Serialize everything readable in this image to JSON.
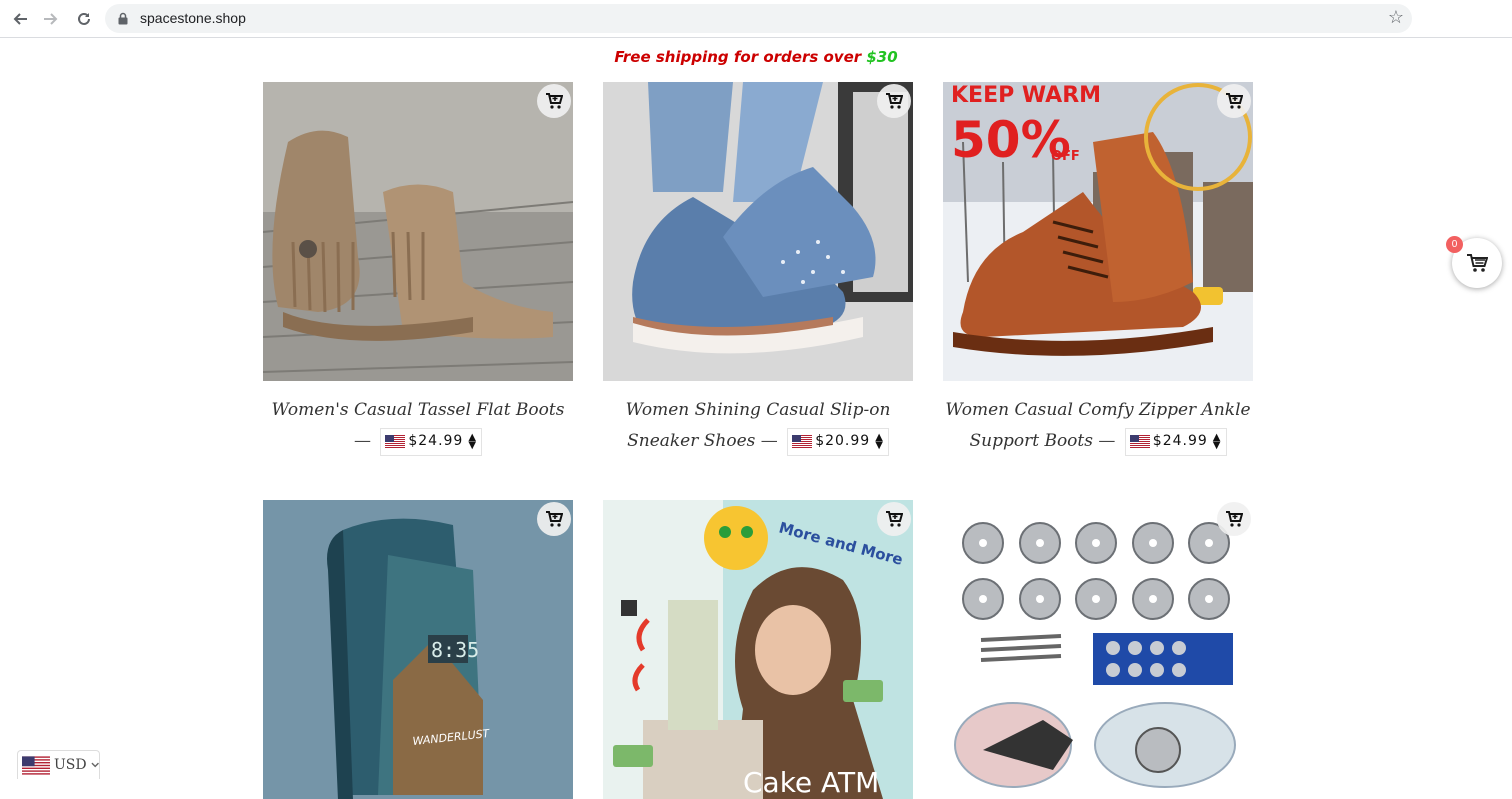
{
  "browser": {
    "url": "spacestone.shop"
  },
  "announcement": {
    "text": "Free shipping for orders over ",
    "amount": "$30"
  },
  "products": [
    {
      "title": "Women's Casual Tassel Flat Boots",
      "separator": "—",
      "price": "$24.99"
    },
    {
      "title": "Women Shining Casual Slip-on Sneaker Shoes",
      "separator": "—",
      "price": "$20.99"
    },
    {
      "title": "Women Casual Comfy Zipper Ankle Support Boots",
      "separator": "—",
      "price": "$24.99"
    },
    {
      "title": "",
      "separator": "",
      "price": ""
    },
    {
      "title": "",
      "separator": "",
      "price": ""
    },
    {
      "title": "",
      "separator": "",
      "price": ""
    }
  ],
  "product_images": {
    "p3_banner_title": "KEEP WARM",
    "p3_banner_percent": "50%",
    "p3_banner_off": "OFF",
    "p4_text": "WANDERLUST",
    "p4_time": "8:35",
    "p5_text_top": "More and More",
    "p5_text_bottom": "Cake ATM"
  },
  "cart": {
    "count": "0"
  },
  "currency": {
    "code": "USD"
  },
  "icons": {
    "back": "arrow-left-icon",
    "forward": "arrow-right-icon",
    "reload": "reload-icon",
    "lock": "lock-icon",
    "bookmark": "star-icon",
    "add_to_cart": "cart-plus-icon",
    "cart": "cart-icon",
    "flag": "us-flag-icon",
    "price_toggle": "sort-arrows-icon"
  },
  "colors": {
    "announcement_text": "#cc0000",
    "announcement_amount": "#22c322",
    "cart_badge": "#f26060"
  }
}
